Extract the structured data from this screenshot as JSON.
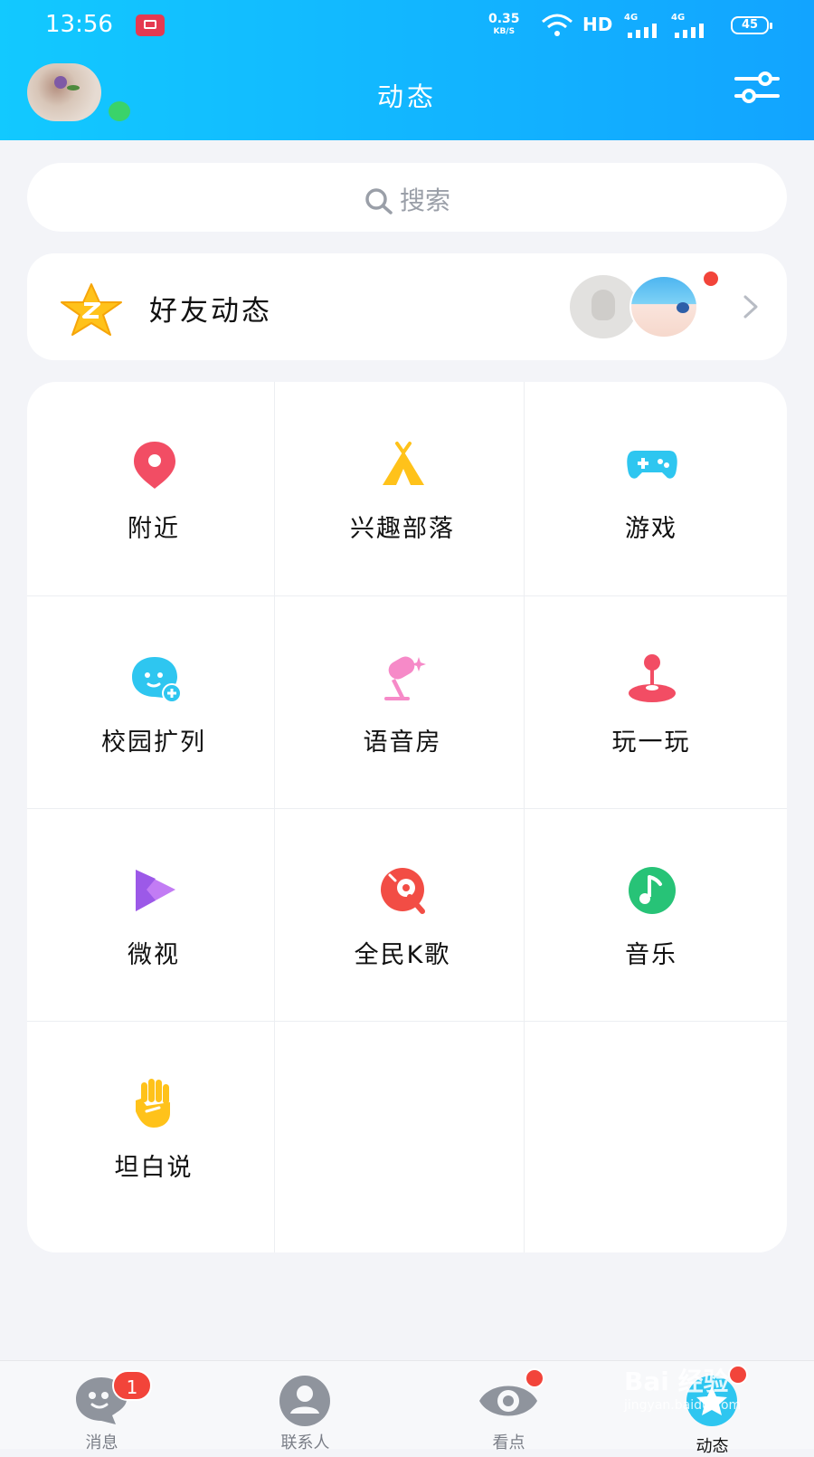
{
  "status_bar": {
    "time": "13:56",
    "net_speed": "0.35",
    "net_unit": "KB/S",
    "hd": "HD",
    "sig1": "4G",
    "sig2": "4G",
    "battery": "45"
  },
  "header": {
    "title": "动态"
  },
  "search": {
    "placeholder": "搜索"
  },
  "friends": {
    "label": "好友动态"
  },
  "grid": {
    "items": [
      {
        "label": "附近",
        "icon": "location-pin-icon"
      },
      {
        "label": "兴趣部落",
        "icon": "tent-icon"
      },
      {
        "label": "游戏",
        "icon": "gamepad-icon"
      },
      {
        "label": "校园扩列",
        "icon": "chat-bubble-plus-icon"
      },
      {
        "label": "语音房",
        "icon": "microphone-icon"
      },
      {
        "label": "玩一玩",
        "icon": "joystick-icon"
      },
      {
        "label": "微视",
        "icon": "play-icon"
      },
      {
        "label": "全民K歌",
        "icon": "karaoke-icon"
      },
      {
        "label": "音乐",
        "icon": "music-note-icon"
      },
      {
        "label": "坦白说",
        "icon": "hand-icon"
      }
    ]
  },
  "tabs": [
    {
      "label": "消息",
      "badge": "1"
    },
    {
      "label": "联系人"
    },
    {
      "label": "看点"
    },
    {
      "label": "动态"
    }
  ],
  "watermark": {
    "line1": "Bai 经验",
    "line2": "jingyan.baidu.com"
  },
  "colors": {
    "header_start": "#12c9ff",
    "header_end": "#12a4ff",
    "badge_red": "#f2443a"
  }
}
